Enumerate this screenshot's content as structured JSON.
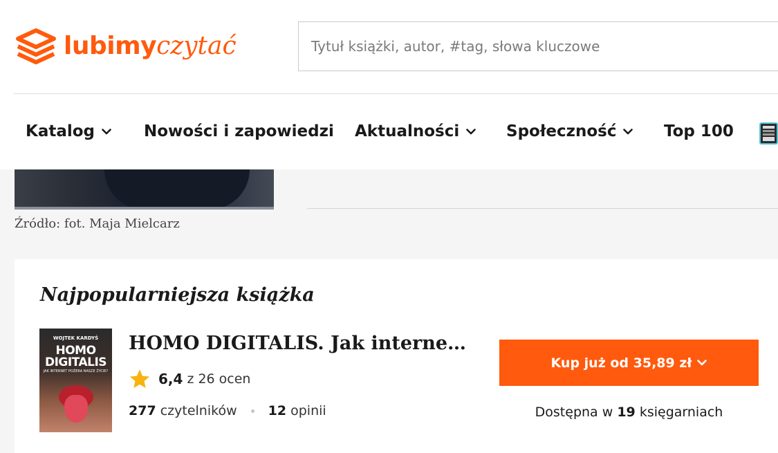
{
  "brand": {
    "part1": "lubimy",
    "part2": "czytać",
    "color": "#ff5a0d"
  },
  "search": {
    "placeholder": "Tytuł książki, autor, #tag, słowa kluczowe"
  },
  "nav": {
    "items": [
      {
        "label": "Katalog",
        "has_dropdown": true
      },
      {
        "label": "Nowości i zapowiedzi",
        "has_dropdown": false
      },
      {
        "label": "Aktualności",
        "has_dropdown": true
      },
      {
        "label": "Społeczność",
        "has_dropdown": true
      },
      {
        "label": "Top 100",
        "has_dropdown": false
      }
    ]
  },
  "article": {
    "photo_caption": "Źródło: fot. Maja Mielcarz"
  },
  "popular_book": {
    "section_title": "Najpopularniejsza książka",
    "cover": {
      "author": "WOJTEK KARDYŚ",
      "title_line1": "HOMO",
      "title_line2": "DIGITALIS",
      "subtitle": "JAK INTERNET POŻERA NASZE ŻYCIE?"
    },
    "title": "HOMO DIGITALIS. Jak internet p...",
    "rating_value": "6,4",
    "rating_suffix": "z 26 ocen",
    "readers_count": "277",
    "readers_label": "czytelników",
    "reviews_count": "12",
    "reviews_label": "opinii",
    "buy_label": "Kup już od 35,89 zł",
    "availability_prefix": "Dostępna w",
    "availability_count": "19",
    "availability_suffix": "księgarniach"
  }
}
